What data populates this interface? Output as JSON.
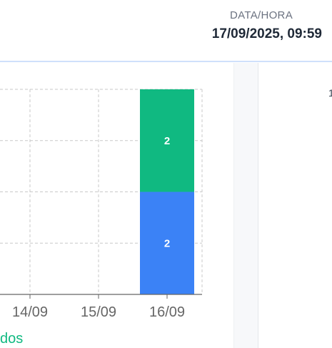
{
  "header": {
    "datetime_label": "DATA/HORA",
    "datetime_value": "17/09/2025, 09:59"
  },
  "legend_fragment": "dos",
  "right_panel": {
    "glyph": "1"
  },
  "colors": {
    "series_green": "#10b981",
    "series_blue": "#3b82f6",
    "grid": "#c9c9c9",
    "axis": "#666666",
    "legend_text": "#10b981"
  },
  "chart_data": {
    "type": "bar",
    "stacked": true,
    "categories": [
      "14/09",
      "15/09",
      "16/09"
    ],
    "series": [
      {
        "color": "#3b82f6",
        "values": [
          0,
          0,
          2
        ]
      },
      {
        "color": "#10b981",
        "values": [
          0,
          0,
          2
        ]
      }
    ],
    "ylim": [
      0,
      4
    ],
    "grid": true,
    "data_labels": true
  }
}
